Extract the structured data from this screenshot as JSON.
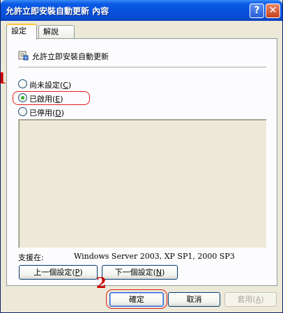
{
  "window": {
    "title": "允許立即安裝自動更新 內容",
    "help_glyph": "?",
    "close_glyph": "✕"
  },
  "tabs": [
    {
      "label": "設定",
      "active": true
    },
    {
      "label": "解說",
      "active": false
    }
  ],
  "policy": {
    "title": "允許立即安裝自動更新",
    "icon": "policy-setting-icon"
  },
  "radios": [
    {
      "label": "尚未設定(",
      "key": "C",
      "suffix": ")",
      "checked": false
    },
    {
      "label": "已啟用(",
      "key": "E",
      "suffix": ")",
      "checked": true
    },
    {
      "label": "已停用(",
      "key": "D",
      "suffix": ")",
      "checked": false
    }
  ],
  "support": {
    "label": "支援在:",
    "value": "Windows Server 2003, XP SP1, 2000 SP3"
  },
  "nav_buttons": {
    "prev": {
      "label": "上一個設定(",
      "key": "P",
      "suffix": ")"
    },
    "next": {
      "label": "下一個設定(",
      "key": "N",
      "suffix": ")"
    }
  },
  "footer_buttons": {
    "ok": "確定",
    "cancel": "取消",
    "apply": {
      "label": "套用(",
      "key": "A",
      "suffix": ")"
    }
  },
  "annotations": {
    "marker_1": "1",
    "marker_2": "2"
  },
  "colors": {
    "title_bar": "#0751dc",
    "highlight": "#e21d1d",
    "marker": "#cc0000",
    "face": "#ece9d8"
  }
}
